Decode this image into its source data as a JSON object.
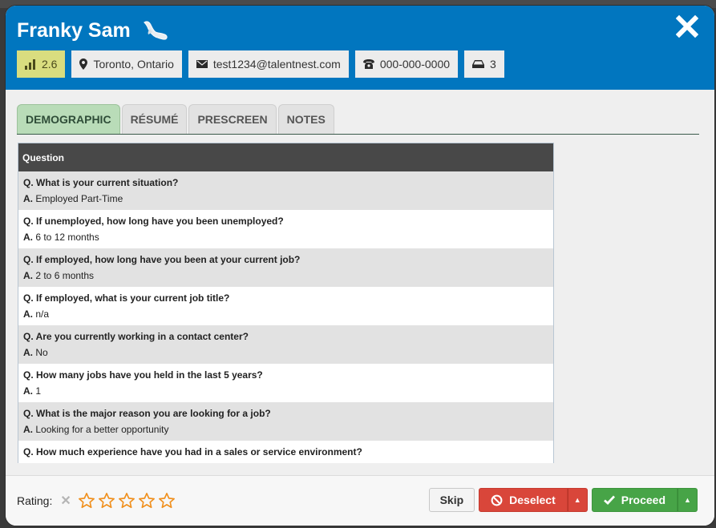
{
  "candidate": {
    "name": "Franky Sam",
    "badge_icon": "bird-icon"
  },
  "chips": {
    "score": {
      "icon": "signal-bars-icon",
      "value": "2.6"
    },
    "location": {
      "icon": "map-pin-icon",
      "value": "Toronto, Ontario"
    },
    "email": {
      "icon": "envelope-icon",
      "value": "test1234@talentnest.com"
    },
    "phone": {
      "icon": "phone-icon",
      "value": "000-000-0000"
    },
    "inbox": {
      "icon": "inbox-icon",
      "value": "3"
    }
  },
  "tabs": [
    {
      "label": "DEMOGRAPHIC",
      "active": true
    },
    {
      "label": "RÉSUMÉ",
      "active": false
    },
    {
      "label": "PRESCREEN",
      "active": false
    },
    {
      "label": "NOTES",
      "active": false
    }
  ],
  "table": {
    "header": "Question",
    "q_prefix": "Q.",
    "a_prefix": "A.",
    "rows": [
      {
        "q": "What is your current situation?",
        "a": "Employed Part-Time"
      },
      {
        "q": "If unemployed, how long have you been unemployed?",
        "a": "6 to 12 months"
      },
      {
        "q": "If employed, how long have you been at your current job?",
        "a": "2 to 6 months"
      },
      {
        "q": "If employed, what is your current job title?",
        "a": "n/a"
      },
      {
        "q": "Are you currently working in a contact center?",
        "a": "No"
      },
      {
        "q": "How many jobs have you held in the last 5 years?",
        "a": "1"
      },
      {
        "q": "What is the major reason you are looking for a job?",
        "a": "Looking for a better opportunity"
      },
      {
        "q": "How much experience have you had in a sales or service environment?",
        "a": ""
      }
    ]
  },
  "footer": {
    "rating_label": "Rating:",
    "rating_value": 0,
    "rating_max": 5,
    "skip_label": "Skip",
    "deselect_label": "Deselect",
    "proceed_label": "Proceed"
  },
  "colors": {
    "header_blue": "#0176bf",
    "score_chip": "#d9dd7f",
    "active_tab": "#b9dcb8",
    "deselect_red": "#d9463a",
    "proceed_green": "#47a447",
    "star_orange": "#f0901e"
  }
}
